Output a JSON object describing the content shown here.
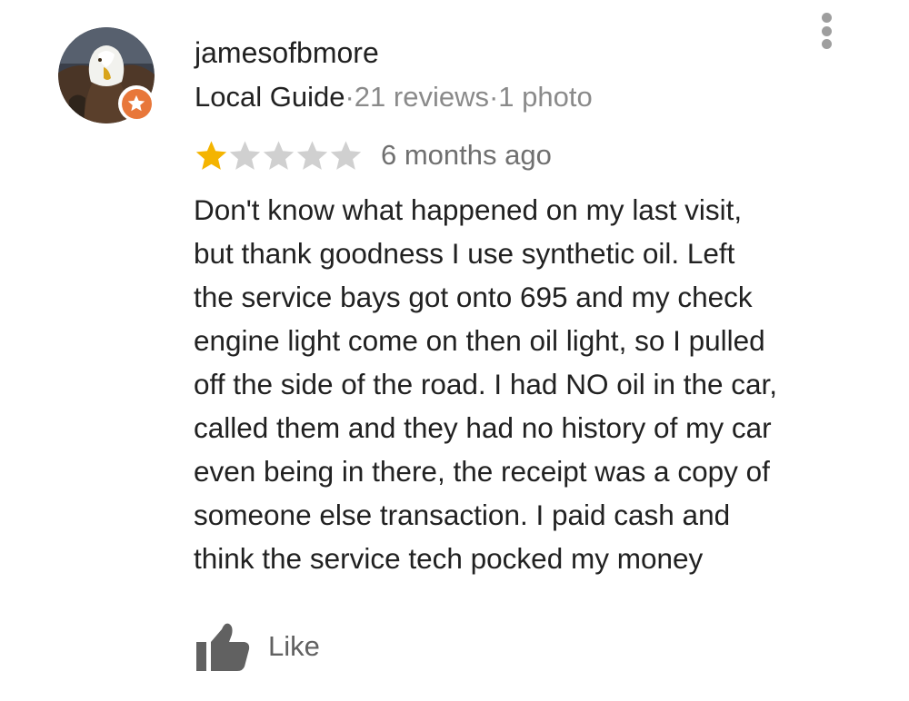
{
  "review": {
    "author": {
      "name": "jamesofbmore",
      "avatar_icon": "bald-eagle-avatar",
      "badge_icon": "local-guide-star-icon",
      "badge_color": "#e8773a"
    },
    "meta": {
      "level": "Local Guide",
      "separator": "·",
      "reviews": "21 reviews",
      "photos": "1 photo"
    },
    "rating": {
      "value": 1,
      "max": 5,
      "filled_color": "#f4b400",
      "empty_color": "#d0d0d0"
    },
    "age": "6 months ago",
    "text": "Don't know what happened on my last visit,\nbut thank goodness I use synthetic oil. Left\nthe service bays got onto 695 and my check\nengine light come on then oil light, so I pulled\noff the side of the road. I had NO oil in the car,\ncalled them and they had no history of my car\neven being in there, the receipt was a copy of\nsomeone else transaction. I paid cash  and\nthink the service tech pocked my money",
    "actions": {
      "like_label": "Like",
      "like_icon": "thumbs-up-icon",
      "more_icon": "more-vert-icon"
    }
  }
}
